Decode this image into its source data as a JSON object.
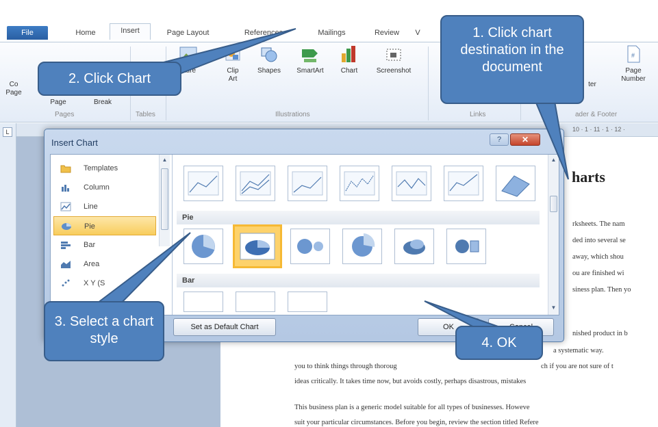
{
  "ribbon": {
    "tabs": [
      {
        "label": "File"
      },
      {
        "label": "Home"
      },
      {
        "label": "Insert"
      },
      {
        "label": "Page Layout"
      },
      {
        "label": "References"
      },
      {
        "label": "Mailings"
      },
      {
        "label": "Review"
      },
      {
        "label": "V"
      }
    ],
    "items": {
      "cover_page": "Co\nPage",
      "blank_page": "Page",
      "page_break": "Break",
      "picture": "cture",
      "clip_art": "Clip\nArt",
      "shapes": "Shapes",
      "smartart": "SmartArt",
      "chart": "Chart",
      "screenshot": "Screenshot",
      "footer": "ter",
      "page_number": "Page\nNumber"
    },
    "groups": {
      "pages": "Pages",
      "tables": "Tables",
      "illustrations": "Illustrations",
      "links": "Links",
      "header_footer": "ader & Footer"
    },
    "ruler_text": "10 · 1 · 11 · 1 · 12 ·"
  },
  "dialog": {
    "title": "Insert Chart",
    "help": "?",
    "close": "✕",
    "categories": [
      {
        "label": "Templates",
        "icon": "folder-icon"
      },
      {
        "label": "Column",
        "icon": "column-chart-icon"
      },
      {
        "label": "Line",
        "icon": "line-chart-icon"
      },
      {
        "label": "Pie",
        "icon": "pie-chart-icon",
        "selected": true
      },
      {
        "label": "Bar",
        "icon": "bar-chart-icon"
      },
      {
        "label": "Area",
        "icon": "area-chart-icon"
      },
      {
        "label": "X Y (S",
        "icon": "scatter-chart-icon"
      }
    ],
    "sections": {
      "pie": "Pie",
      "bar": "Bar"
    },
    "buttons": {
      "set_default": "Set as Default Chart",
      "ok": "OK",
      "cancel": "Cancel"
    }
  },
  "document": {
    "heading": "harts",
    "lines_right": [
      "rksheets. The nam",
      "ded into several se",
      "away, which shou",
      "ou are finished wi",
      "siness plan. Then yo"
    ],
    "line_finished": "nished product in b",
    "line_systematic": "a systematic way.",
    "line_you": "you to think things through thoroug",
    "line_you2": "ch if you are not sure of t",
    "line_ideas": "ideas critically. It takes time now, but avoids costly, perhaps disastrous, mistakes",
    "line_business": "This business plan is a generic model suitable for all types of businesses. Howeve",
    "line_suit": "suit your particular circumstances. Before you begin, review the section titled Refere"
  },
  "callouts": {
    "step1": "1. Click chart destination in the document",
    "step2": "2. Click Chart",
    "step3": "3. Select a chart style",
    "step4": "4. OK"
  },
  "colors": {
    "callout_fill": "#4f81bd",
    "selection": "#f8cd5d",
    "ribbon_bg": "#e4ecf7"
  }
}
